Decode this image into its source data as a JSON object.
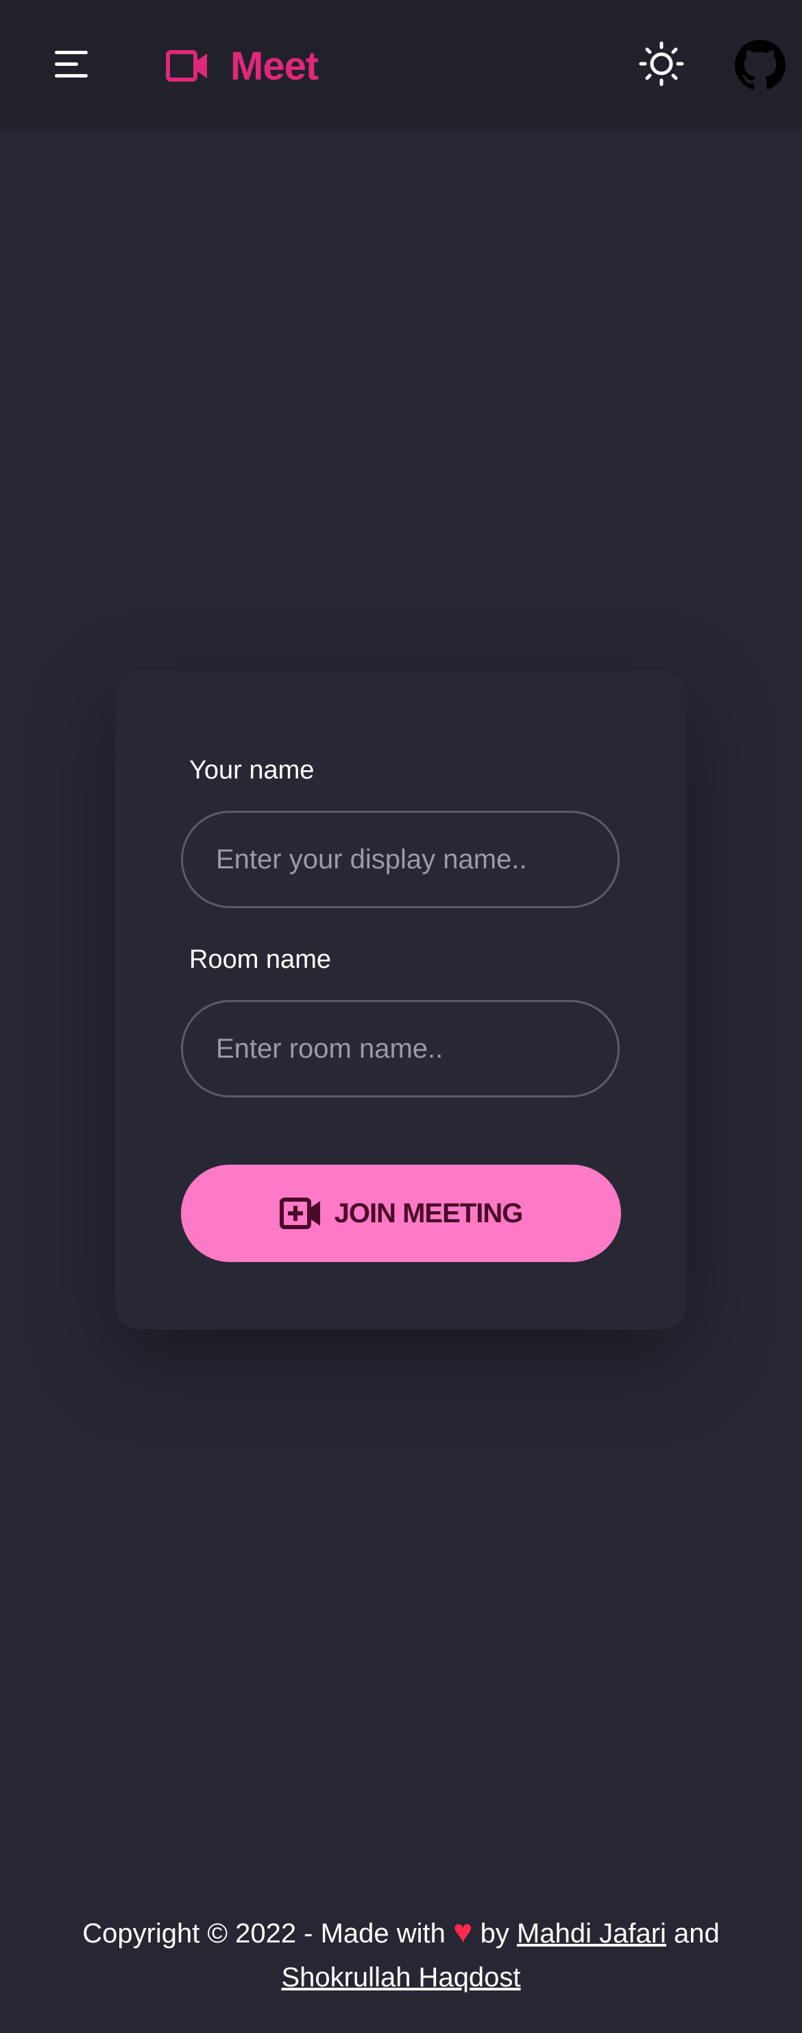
{
  "header": {
    "brand": "Meet",
    "brand_color": "#e0287a",
    "icons": {
      "menu": "menu-icon",
      "logo": "video-camera-icon",
      "theme": "sun-icon",
      "github": "github-icon"
    }
  },
  "form": {
    "name_label": "Your name",
    "name_placeholder": "Enter your display name..",
    "name_value": "",
    "room_label": "Room name",
    "room_placeholder": "Enter room name..",
    "room_value": "",
    "join_label": "JOIN MEETING",
    "join_icon": "video-plus-icon",
    "button_color": "#ff7ac6"
  },
  "footer": {
    "prefix": "Copyright © 2022 - Made with",
    "heart": "♥",
    "by": "by",
    "author1": "Mahdi Jafari",
    "and": "and",
    "author2": "Shokrullah Haqdost"
  },
  "colors": {
    "background": "#262733",
    "header_background": "#20212a",
    "heart": "#ff2a4d"
  }
}
